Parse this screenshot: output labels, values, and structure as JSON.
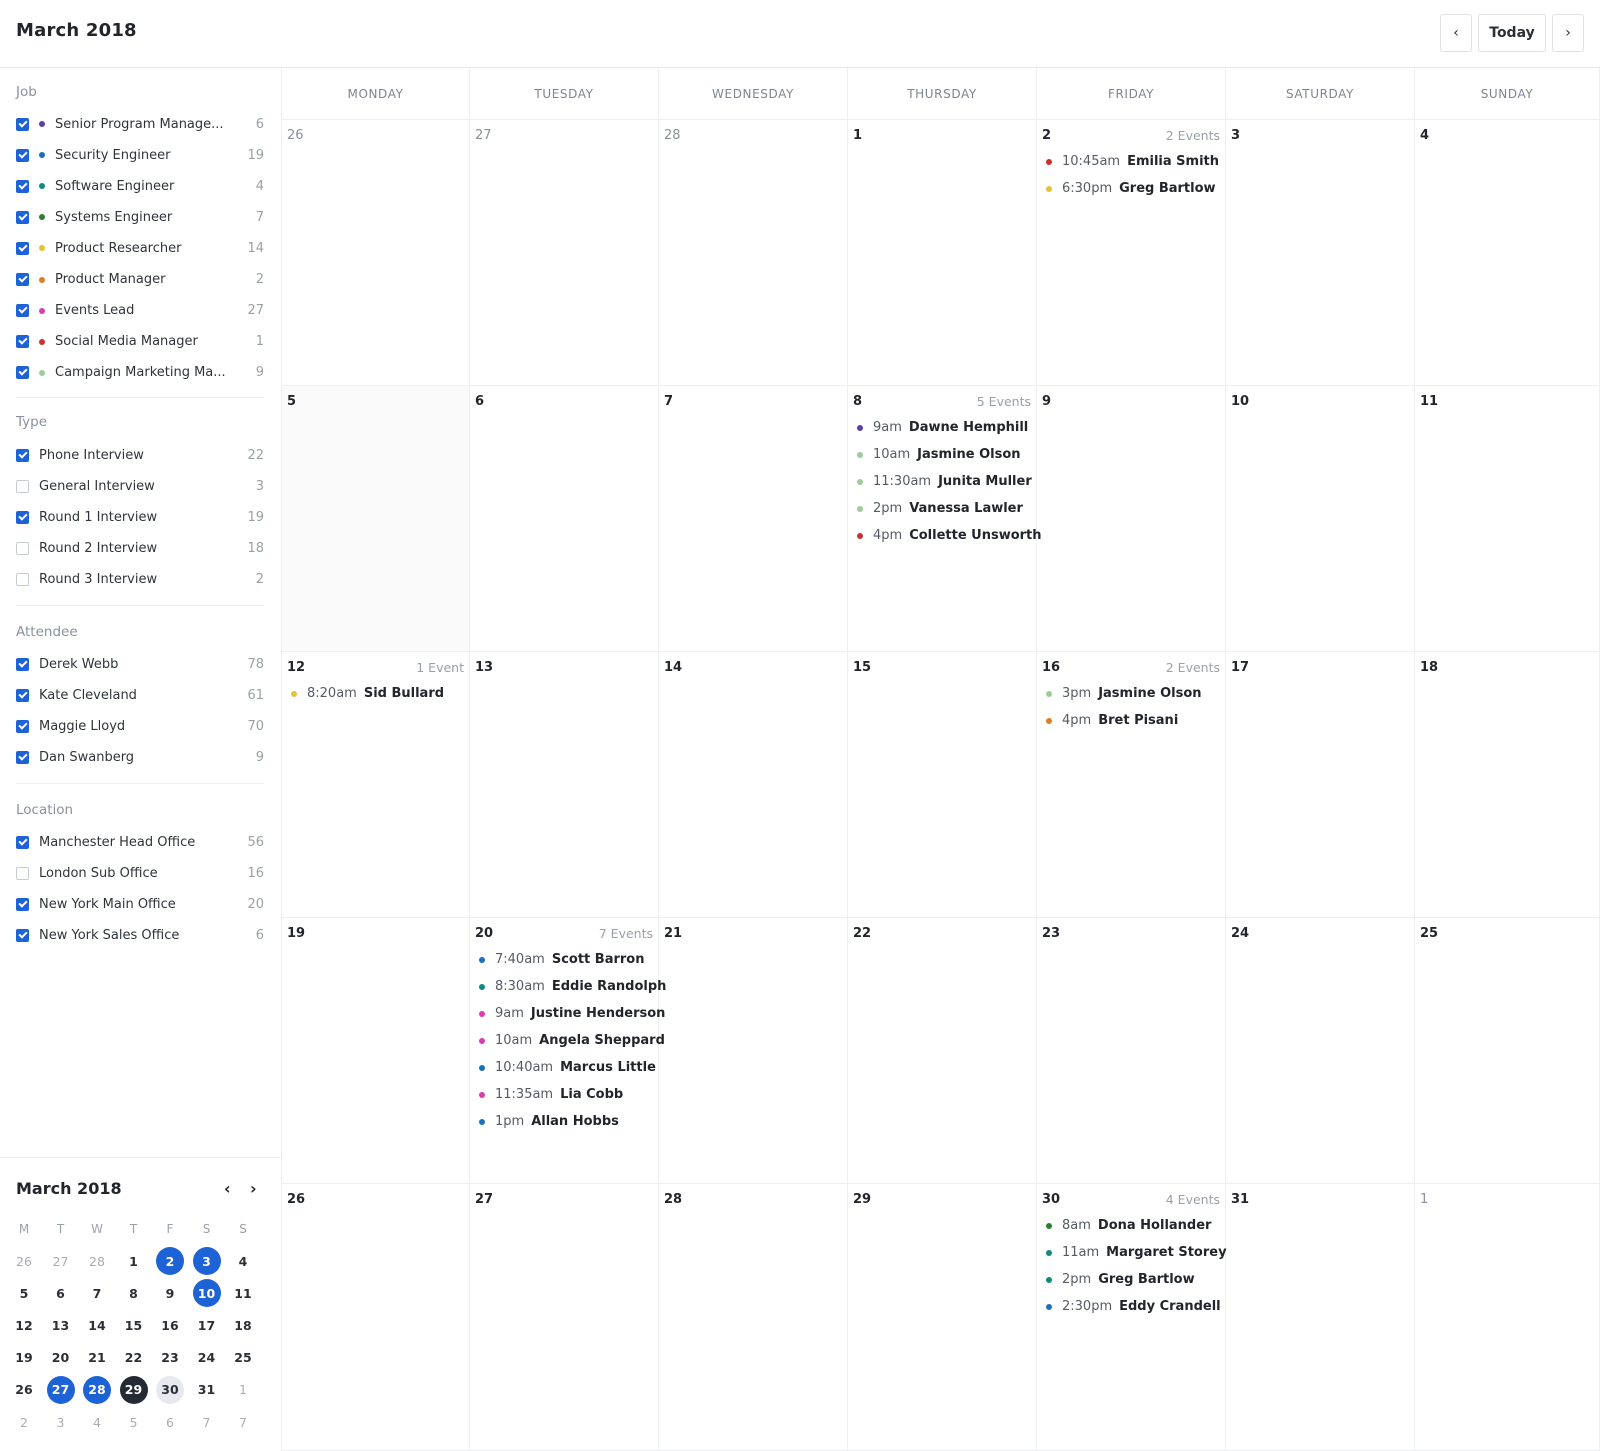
{
  "header": {
    "title": "March 2018",
    "prev_icon": "chevron-left-icon",
    "today_label": "Today",
    "next_icon": "chevron-right-icon",
    "prev_glyph": "‹",
    "next_glyph": "›"
  },
  "colors": {
    "accent": "#1e63d6",
    "purple": "#5b3fa6",
    "blue": "#1f6fb8",
    "teal": "#138a7e",
    "green": "#2f7d32",
    "yellow": "#e5c23a",
    "orange": "#e07b28",
    "pink": "#d63fae",
    "red": "#c9312c",
    "light_green": "#9fcc9a"
  },
  "filters": {
    "job": {
      "title": "Job",
      "items": [
        {
          "label": "Senior Program Manage...",
          "count": "6",
          "checked": true,
          "color": "#5b3fa6"
        },
        {
          "label": "Security Engineer",
          "count": "19",
          "checked": true,
          "color": "#1f6fb8"
        },
        {
          "label": "Software Engineer",
          "count": "4",
          "checked": true,
          "color": "#138a7e"
        },
        {
          "label": "Systems Engineer",
          "count": "7",
          "checked": true,
          "color": "#2f7d32"
        },
        {
          "label": "Product Researcher",
          "count": "14",
          "checked": true,
          "color": "#e5c23a"
        },
        {
          "label": "Product Manager",
          "count": "2",
          "checked": true,
          "color": "#e07b28"
        },
        {
          "label": "Events Lead",
          "count": "27",
          "checked": true,
          "color": "#d63fae"
        },
        {
          "label": "Social Media Manager",
          "count": "1",
          "checked": true,
          "color": "#c9312c"
        },
        {
          "label": "Campaign Marketing Ma...",
          "count": "9",
          "checked": true,
          "color": "#9fcc9a"
        }
      ]
    },
    "type": {
      "title": "Type",
      "items": [
        {
          "label": "Phone Interview",
          "count": "22",
          "checked": true
        },
        {
          "label": "General Interview",
          "count": "3",
          "checked": false
        },
        {
          "label": "Round 1 Interview",
          "count": "19",
          "checked": true
        },
        {
          "label": "Round 2 Interview",
          "count": "18",
          "checked": false
        },
        {
          "label": "Round 3 Interview",
          "count": "2",
          "checked": false
        }
      ]
    },
    "attendee": {
      "title": "Attendee",
      "items": [
        {
          "label": "Derek Webb",
          "count": "78",
          "checked": true
        },
        {
          "label": "Kate Cleveland",
          "count": "61",
          "checked": true
        },
        {
          "label": "Maggie Lloyd",
          "count": "70",
          "checked": true
        },
        {
          "label": "Dan Swanberg",
          "count": "9",
          "checked": true
        }
      ]
    },
    "location": {
      "title": "Location",
      "items": [
        {
          "label": "Manchester Head Office",
          "count": "56",
          "checked": true
        },
        {
          "label": "London Sub Office",
          "count": "16",
          "checked": false
        },
        {
          "label": "New York Main Office",
          "count": "20",
          "checked": true
        },
        {
          "label": "New York Sales Office",
          "count": "6",
          "checked": true
        }
      ]
    }
  },
  "mini_calendar": {
    "title": "March 2018",
    "prev_glyph": "‹",
    "next_glyph": "›",
    "weekday_headers": [
      "M",
      "T",
      "W",
      "T",
      "F",
      "S",
      "S"
    ],
    "weeks": [
      [
        {
          "d": "26",
          "s": "muted"
        },
        {
          "d": "27",
          "s": "muted"
        },
        {
          "d": "28",
          "s": "muted"
        },
        {
          "d": "1",
          "s": ""
        },
        {
          "d": "2",
          "s": "sel"
        },
        {
          "d": "3",
          "s": "sel"
        },
        {
          "d": "4",
          "s": ""
        }
      ],
      [
        {
          "d": "5",
          "s": ""
        },
        {
          "d": "6",
          "s": ""
        },
        {
          "d": "7",
          "s": ""
        },
        {
          "d": "8",
          "s": ""
        },
        {
          "d": "9",
          "s": ""
        },
        {
          "d": "10",
          "s": "sel"
        },
        {
          "d": "11",
          "s": ""
        }
      ],
      [
        {
          "d": "12",
          "s": ""
        },
        {
          "d": "13",
          "s": ""
        },
        {
          "d": "14",
          "s": ""
        },
        {
          "d": "15",
          "s": ""
        },
        {
          "d": "16",
          "s": ""
        },
        {
          "d": "17",
          "s": ""
        },
        {
          "d": "18",
          "s": ""
        }
      ],
      [
        {
          "d": "19",
          "s": ""
        },
        {
          "d": "20",
          "s": ""
        },
        {
          "d": "21",
          "s": ""
        },
        {
          "d": "22",
          "s": ""
        },
        {
          "d": "23",
          "s": ""
        },
        {
          "d": "24",
          "s": ""
        },
        {
          "d": "25",
          "s": ""
        }
      ],
      [
        {
          "d": "26",
          "s": ""
        },
        {
          "d": "27",
          "s": "sel"
        },
        {
          "d": "28",
          "s": "sel"
        },
        {
          "d": "29",
          "s": "cur"
        },
        {
          "d": "30",
          "s": "hover"
        },
        {
          "d": "31",
          "s": ""
        },
        {
          "d": "1",
          "s": "muted"
        }
      ],
      [
        {
          "d": "2",
          "s": "muted"
        },
        {
          "d": "3",
          "s": "muted"
        },
        {
          "d": "4",
          "s": "muted"
        },
        {
          "d": "5",
          "s": "muted"
        },
        {
          "d": "6",
          "s": "muted"
        },
        {
          "d": "7",
          "s": "muted"
        },
        {
          "d": "7",
          "s": "muted"
        }
      ]
    ]
  },
  "calendar": {
    "weekdays": [
      "MONDAY",
      "TUESDAY",
      "WEDNESDAY",
      "THURSDAY",
      "FRIDAY",
      "SATURDAY",
      "SUNDAY"
    ],
    "weeks": [
      [
        {
          "date": "26",
          "muted": true
        },
        {
          "date": "27",
          "muted": true
        },
        {
          "date": "28",
          "muted": true
        },
        {
          "date": "1"
        },
        {
          "date": "2",
          "count": "2 Events",
          "events": [
            {
              "time": "10:45am",
              "name": "Emilia Smith",
              "color": "#c9312c"
            },
            {
              "time": "6:30pm",
              "name": "Greg Bartlow",
              "color": "#e5c23a"
            }
          ]
        },
        {
          "date": "3"
        },
        {
          "date": "4"
        }
      ],
      [
        {
          "date": "5",
          "shaded": true
        },
        {
          "date": "6"
        },
        {
          "date": "7"
        },
        {
          "date": "8",
          "count": "5 Events",
          "events": [
            {
              "time": "9am",
              "name": "Dawne Hemphill",
              "color": "#5b3fa6"
            },
            {
              "time": "10am",
              "name": "Jasmine Olson",
              "color": "#9fcc9a"
            },
            {
              "time": "11:30am",
              "name": "Junita Muller",
              "color": "#9fcc9a"
            },
            {
              "time": "2pm",
              "name": "Vanessa Lawler",
              "color": "#9fcc9a"
            },
            {
              "time": "4pm",
              "name": "Collette Unsworth",
              "color": "#c9312c"
            }
          ]
        },
        {
          "date": "9"
        },
        {
          "date": "10"
        },
        {
          "date": "11"
        }
      ],
      [
        {
          "date": "12",
          "count": "1 Event",
          "events": [
            {
              "time": "8:20am",
              "name": "Sid Bullard",
              "color": "#e5c23a"
            }
          ]
        },
        {
          "date": "13"
        },
        {
          "date": "14"
        },
        {
          "date": "15"
        },
        {
          "date": "16",
          "count": "2 Events",
          "events": [
            {
              "time": "3pm",
              "name": "Jasmine Olson",
              "color": "#9fcc9a"
            },
            {
              "time": "4pm",
              "name": "Bret Pisani",
              "color": "#e07b28"
            }
          ]
        },
        {
          "date": "17"
        },
        {
          "date": "18"
        }
      ],
      [
        {
          "date": "19"
        },
        {
          "date": "20",
          "count": "7 Events",
          "events": [
            {
              "time": "7:40am",
              "name": "Scott Barron",
              "color": "#1f6fb8"
            },
            {
              "time": "8:30am",
              "name": "Eddie Randolph",
              "color": "#138a7e"
            },
            {
              "time": "9am",
              "name": "Justine Henderson",
              "color": "#d63fae"
            },
            {
              "time": "10am",
              "name": "Angela Sheppard",
              "color": "#d63fae"
            },
            {
              "time": "10:40am",
              "name": "Marcus Little",
              "color": "#1f6fb8"
            },
            {
              "time": "11:35am",
              "name": "Lia Cobb",
              "color": "#d63fae"
            },
            {
              "time": "1pm",
              "name": "Allan Hobbs",
              "color": "#1f6fb8"
            }
          ]
        },
        {
          "date": "21"
        },
        {
          "date": "22"
        },
        {
          "date": "23"
        },
        {
          "date": "24"
        },
        {
          "date": "25"
        }
      ],
      [
        {
          "date": "26"
        },
        {
          "date": "27"
        },
        {
          "date": "28"
        },
        {
          "date": "29"
        },
        {
          "date": "30",
          "count": "4 Events",
          "events": [
            {
              "time": "8am",
              "name": "Dona Hollander",
              "color": "#2f7d32"
            },
            {
              "time": "11am",
              "name": "Margaret Storey",
              "color": "#138a7e"
            },
            {
              "time": "2pm",
              "name": "Greg Bartlow",
              "color": "#138a7e"
            },
            {
              "time": "2:30pm",
              "name": "Eddy Crandell",
              "color": "#1f6fb8"
            }
          ]
        },
        {
          "date": "31"
        },
        {
          "date": "1",
          "muted": true
        }
      ]
    ]
  }
}
